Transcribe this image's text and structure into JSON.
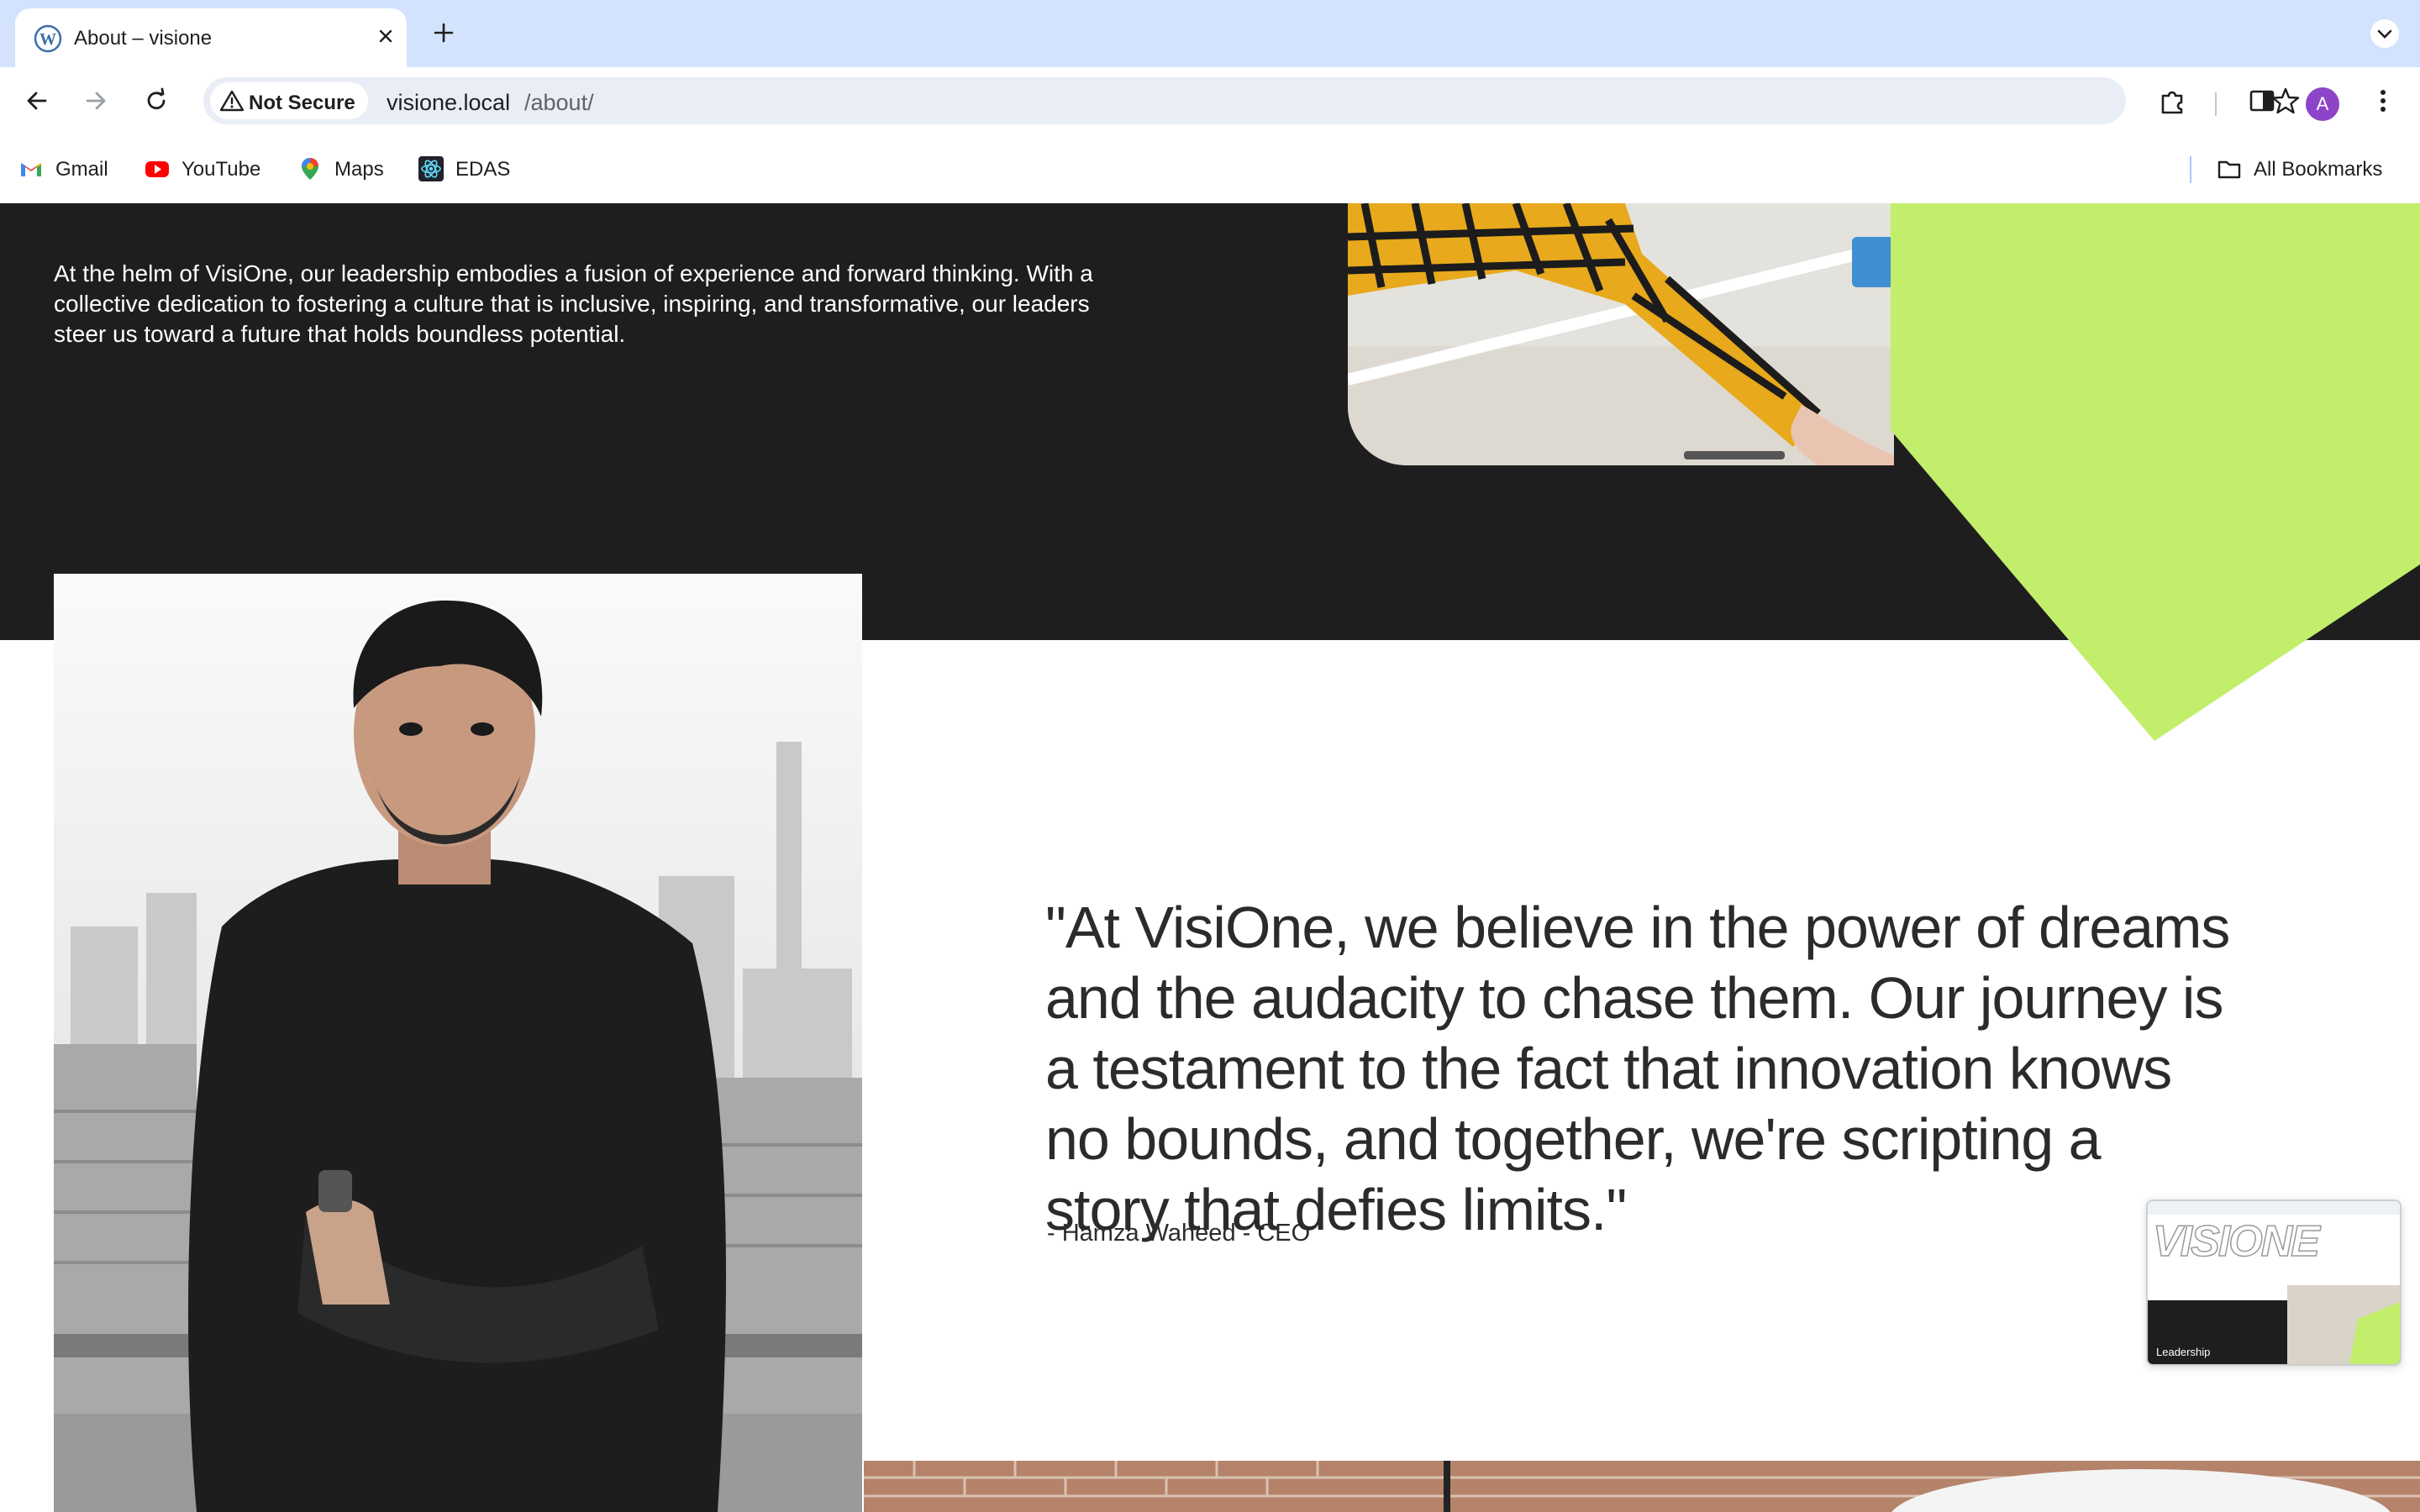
{
  "browser": {
    "tab_title": "About – visione",
    "security_label": "Not Secure",
    "url_host": "visione.local",
    "url_path": "/about/",
    "avatar_letter": "A",
    "bookmarks": [
      {
        "label": "Gmail",
        "icon": "gmail-icon"
      },
      {
        "label": "YouTube",
        "icon": "youtube-icon"
      },
      {
        "label": "Maps",
        "icon": "maps-icon"
      },
      {
        "label": "EDAS",
        "icon": "react-icon"
      }
    ],
    "all_bookmarks_label": "All Bookmarks"
  },
  "page": {
    "intro_text": "At the helm of VisiOne, our leadership embodies a fusion of experience and forward thinking. With a collective dedication to fostering a culture that is inclusive, inspiring, and transformative, our leaders steer us toward a future that holds boundless potential.",
    "quote": "\"At VisiOne, we believe in the power of dreams and the audacity to chase them. Our journey is a testament to the fact that innovation knows no bounds, and together, we're scripting a story that defies limits.\"",
    "attribution": "- Hamza Waheed - CEO",
    "thumbnail": {
      "logo_text": "VISIONE",
      "caption": "Leadership"
    }
  },
  "colors": {
    "accent_lime": "#c2ee6c",
    "dark_band": "#1e1e1e",
    "tabstrip": "#d3e3fd"
  }
}
